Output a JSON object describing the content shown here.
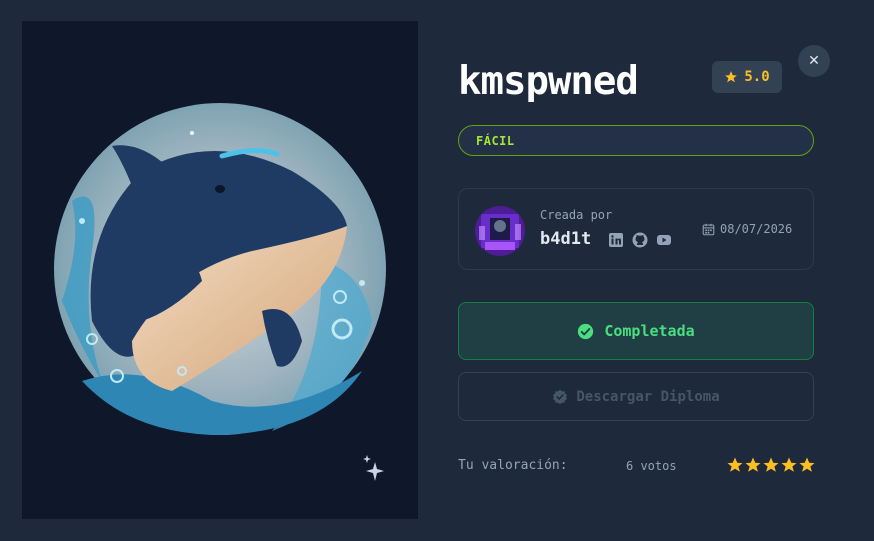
{
  "challenge": {
    "title": "kmspwned",
    "rating": "5.0",
    "difficulty": "FÁCIL"
  },
  "creator": {
    "label": "Creada por",
    "name": "b4d1t",
    "date": "08/07/2026",
    "social_icons": [
      "linkedin-icon",
      "github-icon",
      "youtube-icon"
    ]
  },
  "actions": {
    "completed_label": "Completada",
    "diploma_label": "Descargar Diploma",
    "close_icon": "close-icon"
  },
  "user_rating": {
    "label": "Tu valoración:",
    "votes": "6 votos",
    "stars": 5,
    "max_stars": 5
  },
  "colors": {
    "background": "#1e293b",
    "panel": "#0f172a",
    "accent_green": "#4ade80",
    "difficulty_green": "#a3e635",
    "star": "#fbbf24"
  }
}
